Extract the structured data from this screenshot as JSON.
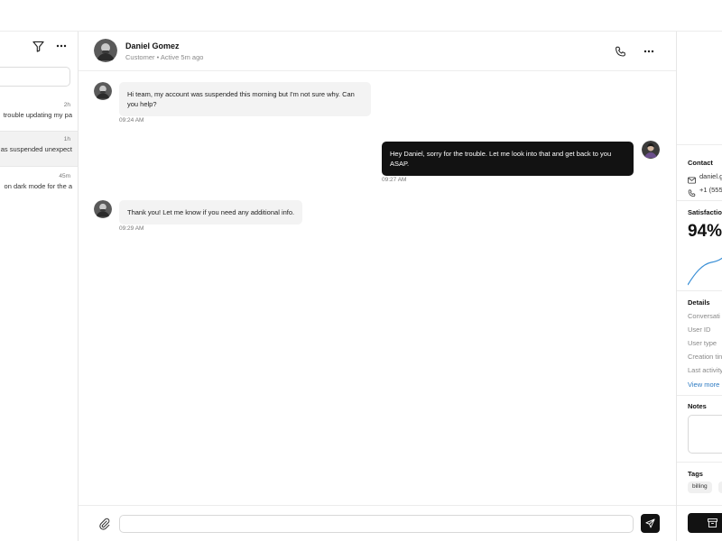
{
  "conversation_list": {
    "items": [
      {
        "time": "2h",
        "snippet": "trouble updating my pa"
      },
      {
        "time": "1h",
        "snippet": "as suspended unexpect"
      },
      {
        "time": "45m",
        "snippet": "on dark mode for the a"
      }
    ]
  },
  "chat": {
    "contact_name": "Daniel Gomez",
    "contact_meta": "Customer • Active 5m ago",
    "messages": [
      {
        "direction": "incoming",
        "text": "Hi team, my account was suspended this morning but I'm not sure why. Can you help?",
        "time": "09:24 AM"
      },
      {
        "direction": "outgoing",
        "text": "Hey Daniel, sorry for the trouble. Let me look into that and get back to you ASAP.",
        "time": "09:27 AM"
      },
      {
        "direction": "incoming",
        "text": "Thank you! Let me know if you need any additional info.",
        "time": "09:29 AM"
      }
    ],
    "composer_placeholder": ""
  },
  "details": {
    "contact_heading": "Contact",
    "email": "daniel.g",
    "phone": "+1 (555",
    "satisfaction_heading": "Satisfaction",
    "satisfaction_value": "94%",
    "details_heading": "Details",
    "fields": [
      "Conversati",
      "User ID",
      "User type",
      "Creation tin",
      "Last activity"
    ],
    "view_more": "View more",
    "notes_heading": "Notes",
    "tags_heading": "Tags",
    "tags": [
      "billing"
    ]
  },
  "colors": {
    "accent_dark": "#121212",
    "link": "#2b79c2",
    "sparkline": "#3a8fd6"
  }
}
